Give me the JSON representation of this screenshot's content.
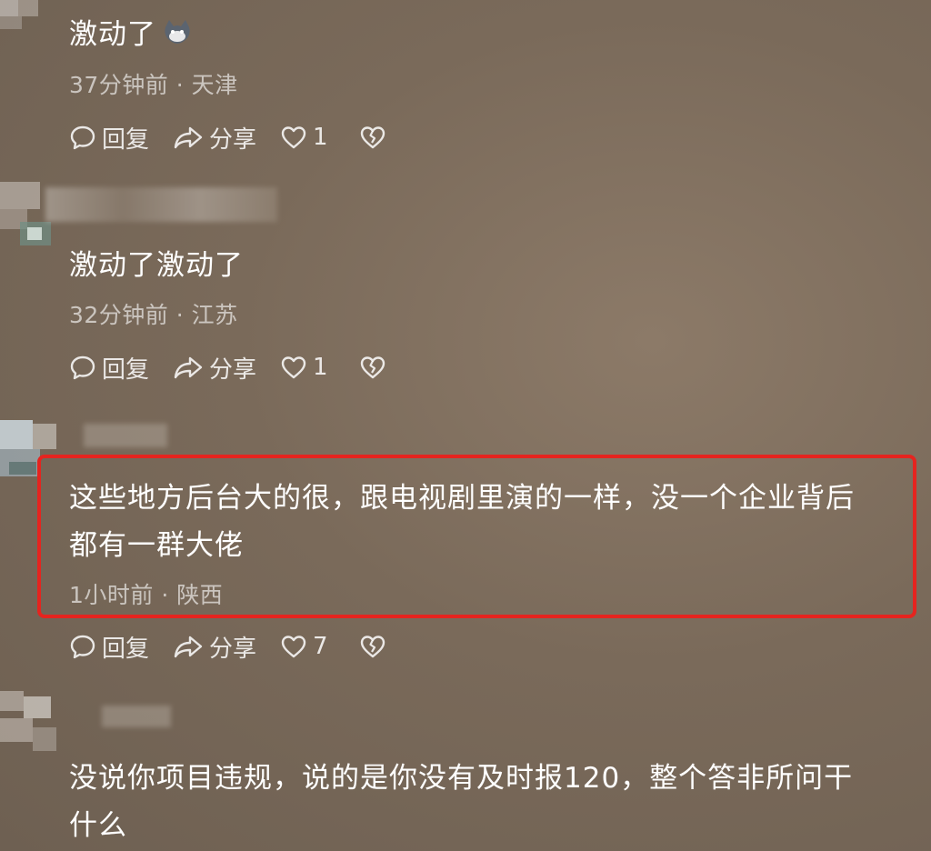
{
  "comments": [
    {
      "text": "激动了",
      "meta": "37分钟前 · 天津",
      "reply": "回复",
      "share": "分享",
      "likes": "1"
    },
    {
      "text": "激动了激动了",
      "meta": "32分钟前 · 江苏",
      "reply": "回复",
      "share": "分享",
      "likes": "1"
    },
    {
      "text_line1": "这些地方后台大的很，跟电视剧里演的一样，没一个企业背后",
      "text_line2": "都有一群大佬",
      "meta": "1小时前 · 陕西",
      "reply": "回复",
      "share": "分享",
      "likes": "7"
    },
    {
      "text_line1": "没说你项目违规，说的是你没有及时报120，整个答非所问干",
      "text_line2": "什么"
    }
  ],
  "colors": {
    "highlight_border": "#e5241f",
    "background": "#7a6a5a"
  }
}
